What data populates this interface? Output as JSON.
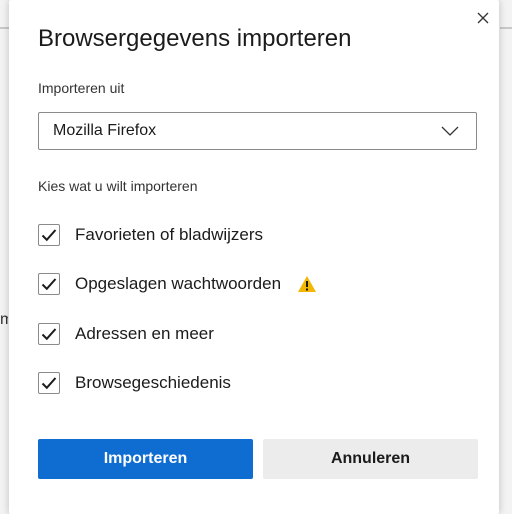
{
  "background": {
    "fragment_text": "m"
  },
  "dialog": {
    "title": "Browsergegevens importeren",
    "close_icon": "close-icon",
    "import_from": {
      "label": "Importeren uit",
      "selected": "Mozilla Firefox",
      "chevron_icon": "chevron-down-icon"
    },
    "choose_label": "Kies wat u wilt importeren",
    "options": [
      {
        "label": "Favorieten of bladwijzers",
        "checked": true
      },
      {
        "label": "Opgeslagen wachtwoorden",
        "checked": true,
        "warning_icon": "warning-icon"
      },
      {
        "label": "Adressen en meer",
        "checked": true
      },
      {
        "label": "Browsegeschiedenis",
        "checked": true
      }
    ],
    "buttons": {
      "primary": "Importeren",
      "secondary": "Annuleren"
    },
    "colors": {
      "primary_button": "#0f6cd1",
      "secondary_button": "#ececec",
      "warning": "#f2b705"
    }
  }
}
